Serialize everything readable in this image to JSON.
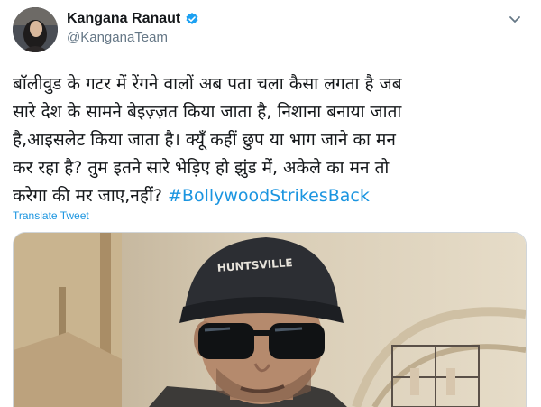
{
  "author": {
    "display_name": "Kangana Ranaut",
    "handle": "@KanganaTeam",
    "verified": true
  },
  "tweet": {
    "lines": [
      "बॉलीवुड के गटर में रेंगने वालों अब पता चला कैसा लगता है जब",
      "सारे देश के सामने बेइज़्ज़त किया जाता है, निशाना बनाया जाता",
      "है,आइसलेट किया जाता है। क्यूँ कहीं छुप या भाग जाने का मन",
      "कर रहा है? तुम इतने सारे भेड़िए हो झुंड में, अकेले का मन तो"
    ],
    "last_line_text": "करेगा की मर जाए,नहीं? ",
    "hashtag": "#BollywoodStrikesBack"
  },
  "translate_label": "Translate Tweet",
  "media": {
    "cap_text": "HUNTSVILLE"
  },
  "colors": {
    "link": "#1b95e0",
    "verified": "#1da1f2",
    "secondary_text": "#657786"
  },
  "icons": [
    "verified-badge-icon",
    "chevron-down-icon"
  ]
}
